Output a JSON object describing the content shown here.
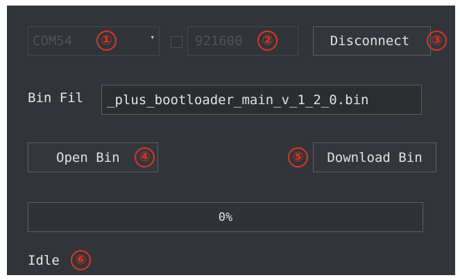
{
  "connection": {
    "port_value": "COM54",
    "baud_value": "921600",
    "disconnect_label": "Disconnect"
  },
  "bin_file": {
    "label": "Bin Fil",
    "path": "_plus_bootloader_main_v_1_2_0.bin"
  },
  "actions": {
    "open_label": "Open Bin",
    "download_label": "Download Bin"
  },
  "progress": {
    "value": 0,
    "text": "0%"
  },
  "status": {
    "text": "Idle"
  },
  "badges": [
    "①",
    "②",
    "③",
    "④",
    "⑤",
    "⑥"
  ],
  "colors": {
    "panel": "#313539",
    "annotation": "#e03428",
    "progress_fill": "#3d8fd6"
  }
}
